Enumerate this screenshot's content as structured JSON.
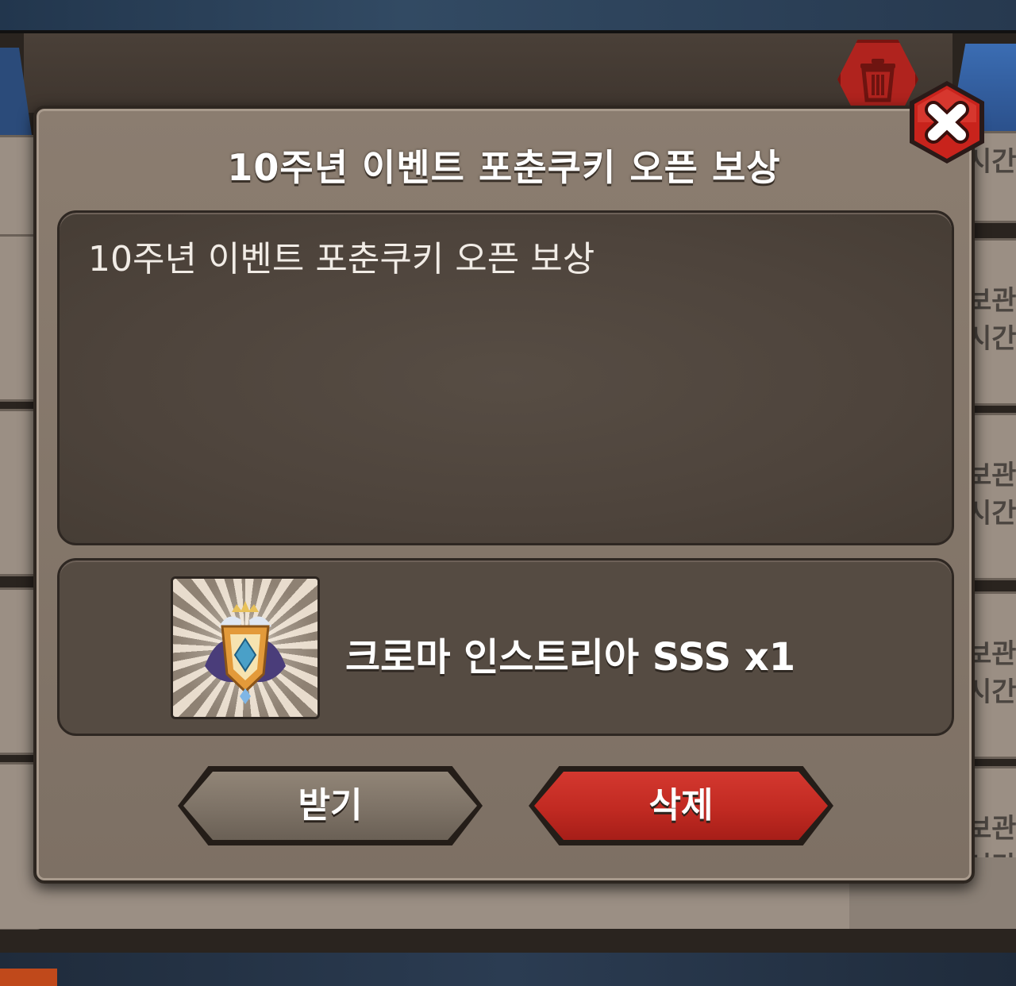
{
  "modal": {
    "title": "10주년 이벤트 포춘쿠키 오픈 보상",
    "message": "10주년 이벤트 포춘쿠키 오픈 보상"
  },
  "reward": {
    "label": "크로마 인스트리아 SSS x1",
    "icon": "chroma-emblem-icon"
  },
  "buttons": {
    "receive_label": "받기",
    "delete_label": "삭제"
  },
  "colors": {
    "delete_button": "#c12a22",
    "receive_button": "#7d7266",
    "close_button": "#c8231c"
  },
  "background": {
    "partial_labels_right": [
      "시간",
      "보관",
      "시간",
      "보관",
      "시간",
      "보관",
      "시간",
      "보관",
      "시간"
    ]
  }
}
